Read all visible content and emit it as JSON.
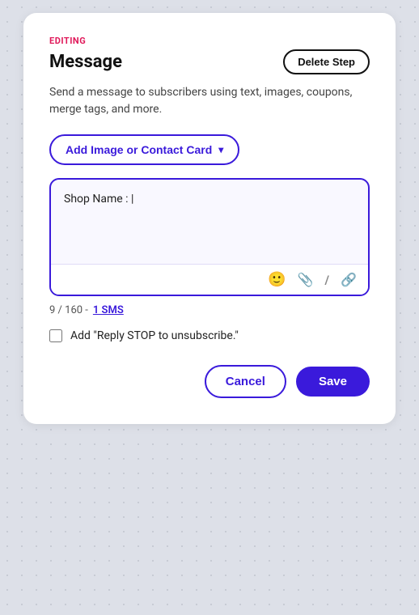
{
  "editing": {
    "label": "EDITING"
  },
  "header": {
    "title": "Message",
    "delete_button_label": "Delete Step"
  },
  "description": {
    "text": "Send a message to subscribers using text, images, coupons, merge tags, and more."
  },
  "add_image_button": {
    "label": "Add Image or Contact Card",
    "chevron": "▾"
  },
  "textarea": {
    "value": "Shop Name : |",
    "placeholder": ""
  },
  "toolbar": {
    "emoji_icon": "😊",
    "attachment_icon": "✂",
    "percent_icon": "%",
    "link_icon": "🔗"
  },
  "char_count": {
    "current": "9",
    "max": "160",
    "separator": "-",
    "sms_label": "1 SMS"
  },
  "checkbox": {
    "label": "Add \"Reply STOP to unsubscribe.\""
  },
  "actions": {
    "cancel_label": "Cancel",
    "save_label": "Save"
  }
}
